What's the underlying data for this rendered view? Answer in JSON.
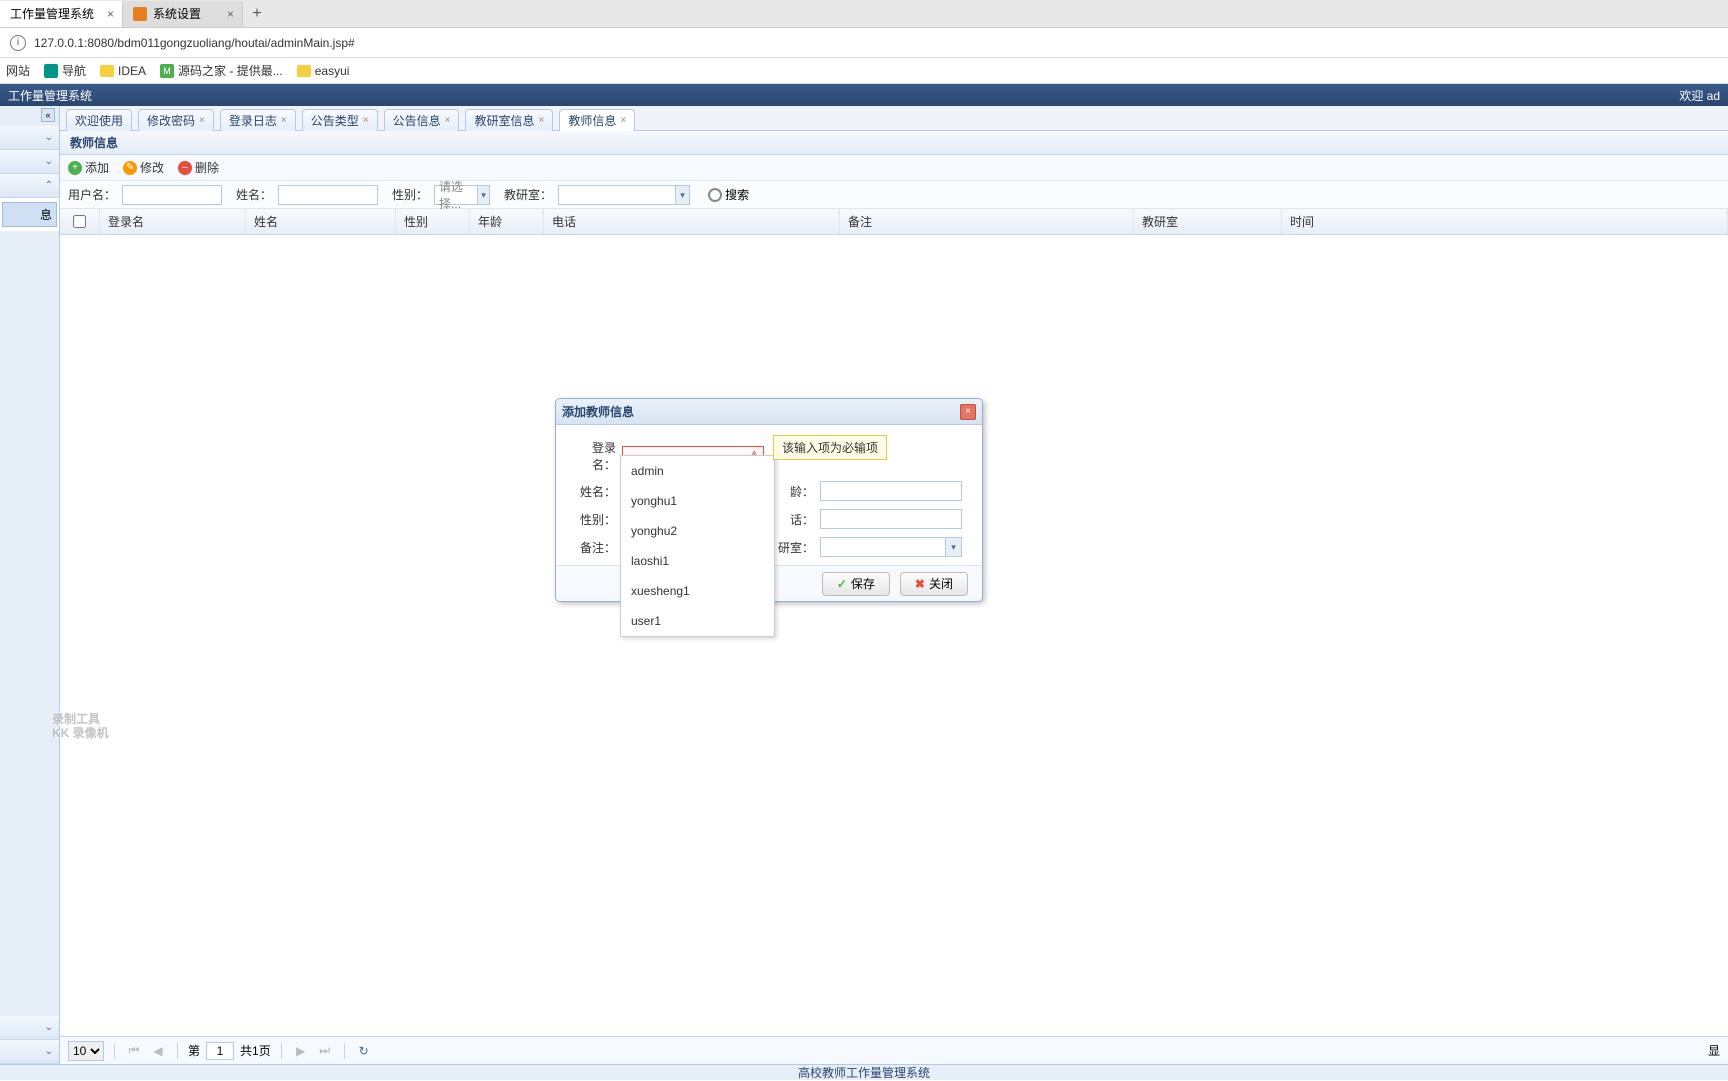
{
  "browserTabs": [
    {
      "label": "工作量管理系统",
      "active": true
    },
    {
      "label": "系统设置",
      "active": false
    }
  ],
  "url": "127.0.0.1:8080/bdm011gongzuoliang/houtai/adminMain.jsp#",
  "bookmarks": {
    "b1": "网站",
    "b2": "导航",
    "b3": "IDEA",
    "b4": "源码之家 - 提供最...",
    "b5": "easyui"
  },
  "appHeader": {
    "title": "工作量管理系统",
    "welcome": "欢迎 ad"
  },
  "innerTabs": {
    "t1": "欢迎使用",
    "t2": "修改密码",
    "t3": "登录日志",
    "t4": "公告类型",
    "t5": "公告信息",
    "t6": "教研室信息",
    "t7": "教师信息"
  },
  "panel": {
    "title": "教师信息"
  },
  "toolbar": {
    "add": "添加",
    "edit": "修改",
    "del": "删除"
  },
  "search": {
    "userLbl": "用户名：",
    "nameLbl": "姓名：",
    "genderLbl": "性别：",
    "genderPh": "请选择...",
    "deptLbl": "教研室：",
    "btn": "搜索"
  },
  "columns": {
    "login": "登录名",
    "name": "姓名",
    "gender": "性别",
    "age": "年龄",
    "phone": "电话",
    "remark": "备注",
    "dept": "教研室",
    "time": "时间"
  },
  "pager": {
    "pageSize": "10",
    "pageLbl": "第",
    "page": "1",
    "total": "共1页"
  },
  "statusBar": "高校教师工作量管理系统",
  "dialog": {
    "title": "添加教师信息",
    "login": "登录名：",
    "name": "姓名：",
    "gender": "性别：",
    "remark": "备注：",
    "age": "龄：",
    "phone": "话：",
    "dept": "研室：",
    "save": "保存",
    "close": "关闭",
    "tooltip": "该输入项为必输项"
  },
  "autocomplete": [
    "admin",
    "yonghu1",
    "yonghu2",
    "laoshi1",
    "xuesheng1",
    "user1"
  ],
  "watermark": {
    "l1": "录制工具",
    "l2": "KK 录像机"
  }
}
